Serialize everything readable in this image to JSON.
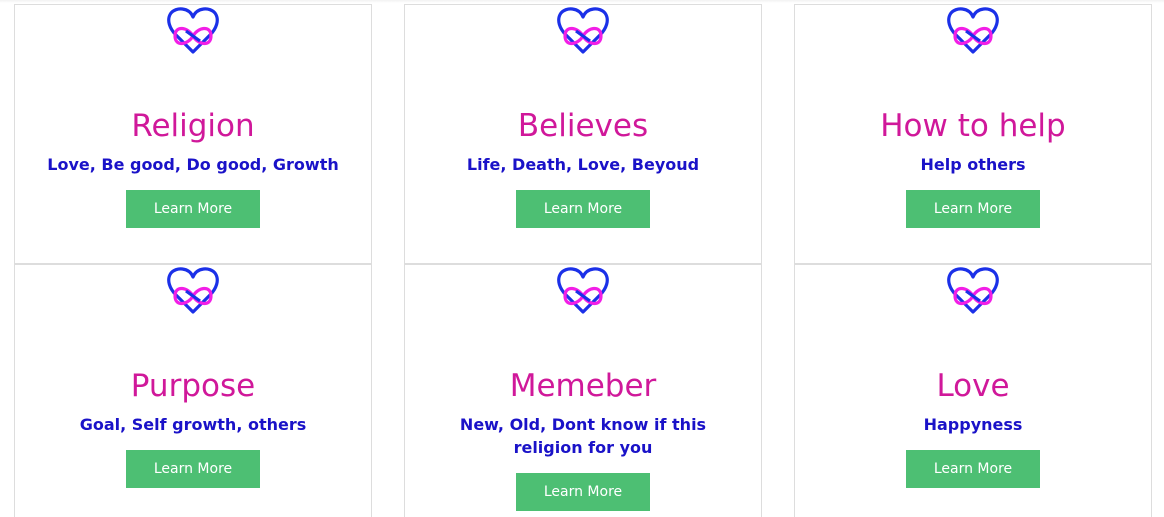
{
  "colors": {
    "title": "#d0189a",
    "description": "#1a12c8",
    "button_bg": "#4dbf73",
    "button_text": "#ffffff",
    "heart_blue": "#1b30e8",
    "heart_magenta": "#f21ee6",
    "card_border": "#dddddd"
  },
  "logo_icon": "heart-infinity-icon",
  "cards": [
    {
      "title": "Religion",
      "description": "Love, Be good, Do good, Growth",
      "button": "Learn More"
    },
    {
      "title": "Believes",
      "description": "Life, Death, Love, Beyoud",
      "button": "Learn More"
    },
    {
      "title": "How to help",
      "description": "Help others",
      "button": "Learn More"
    },
    {
      "title": "Purpose",
      "description": "Goal, Self growth, others",
      "button": "Learn More"
    },
    {
      "title": "Memeber",
      "description": "New, Old, Dont know if this religion for you",
      "button": "Learn More"
    },
    {
      "title": "Love",
      "description": "Happyness",
      "button": "Learn More"
    }
  ]
}
